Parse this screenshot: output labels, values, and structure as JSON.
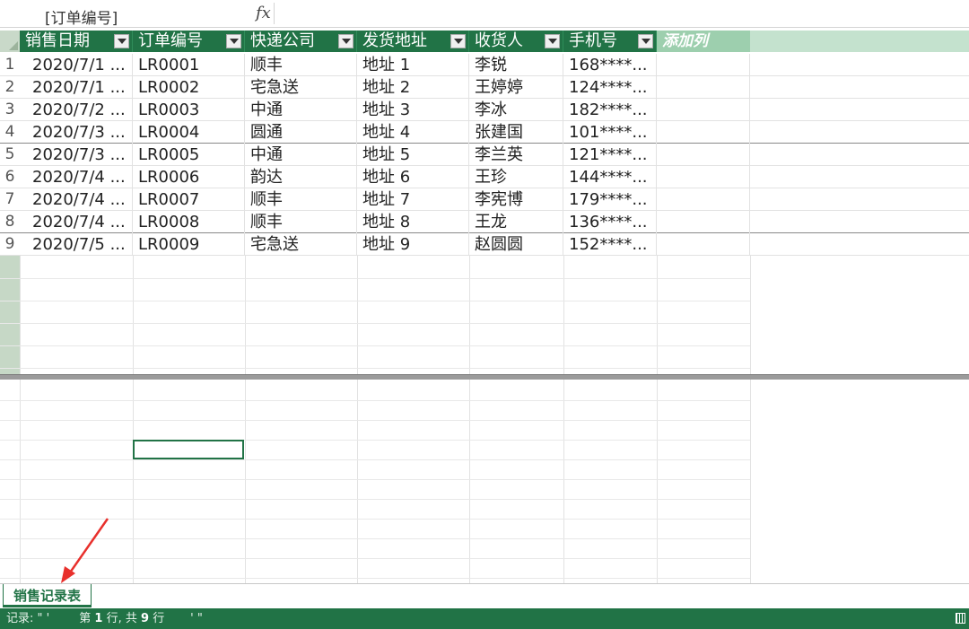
{
  "formula_bar": {
    "name_box": "[订单编号]",
    "fx": "fx"
  },
  "table": {
    "headers": [
      "销售日期",
      "订单编号",
      "快递公司",
      "发货地址",
      "收货人",
      "手机号"
    ],
    "add_column": "添加列",
    "rows": [
      [
        "2020/7/1 ...",
        "LR0001",
        "顺丰",
        "地址 1",
        "李锐",
        "168****..."
      ],
      [
        "2020/7/1 ...",
        "LR0002",
        "宅急送",
        "地址 2",
        "王婷婷",
        "124****..."
      ],
      [
        "2020/7/2 ...",
        "LR0003",
        "中通",
        "地址 3",
        "李冰",
        "182****..."
      ],
      [
        "2020/7/3 ...",
        "LR0004",
        "圆通",
        "地址 4",
        "张建国",
        "101****..."
      ],
      [
        "2020/7/3 ...",
        "LR0005",
        "中通",
        "地址 5",
        "李兰英",
        "121****..."
      ],
      [
        "2020/7/4 ...",
        "LR0006",
        "韵达",
        "地址 6",
        "王珍",
        "144****..."
      ],
      [
        "2020/7/4 ...",
        "LR0007",
        "顺丰",
        "地址 7",
        "李宪博",
        "179****..."
      ],
      [
        "2020/7/4 ...",
        "LR0008",
        "顺丰",
        "地址 8",
        "王龙",
        "136****..."
      ],
      [
        "2020/7/5 ...",
        "LR0009",
        "宅急送",
        "地址 9",
        "赵圆圆",
        "152****..."
      ]
    ]
  },
  "sheet_tab": "销售记录表",
  "status": {
    "prefix": "记录: \" '",
    "row_prefix": "第",
    "row_num": "1",
    "row_mid": "行, 共",
    "total": "9",
    "row_suffix": "行",
    "tail": "' \""
  },
  "colors": {
    "accent": "#217346",
    "add_column_bg": "#9dcfae"
  }
}
